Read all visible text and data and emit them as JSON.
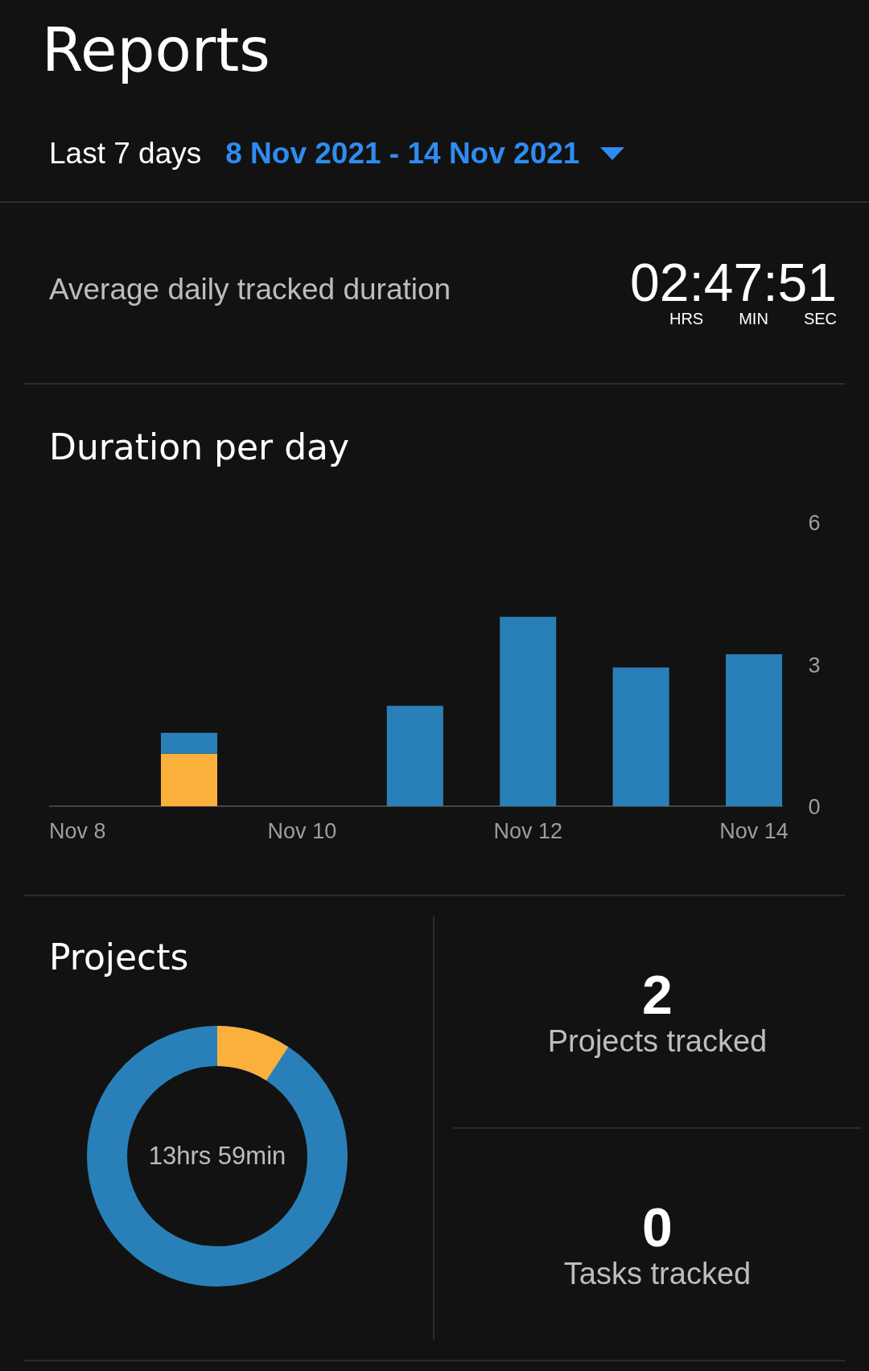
{
  "header": {
    "title": "Reports",
    "range_label": "Last 7 days",
    "date_range": "8 Nov 2021 - 14 Nov 2021"
  },
  "average": {
    "label": "Average daily tracked duration",
    "value": "02:47:51",
    "units": [
      "HRS",
      "MIN",
      "SEC"
    ]
  },
  "duration_per_day": {
    "title": "Duration per day",
    "chart_data": {
      "type": "bar",
      "stacked": true,
      "categories": [
        "Nov 8",
        null,
        "Nov 10",
        null,
        "Nov 12",
        null,
        "Nov 14"
      ],
      "ylim": [
        0,
        6
      ],
      "yticks": [
        0,
        3,
        6
      ],
      "series": [
        {
          "color": "#fbb03b",
          "values": [
            0,
            1.11,
            0,
            0,
            0,
            0,
            0
          ]
        },
        {
          "color": "#2980b9",
          "values": [
            0,
            0.44,
            0,
            2.12,
            4.0,
            2.93,
            3.21
          ]
        }
      ]
    }
  },
  "projects": {
    "title": "Projects",
    "total": "13hrs 59min"
  },
  "stats": [
    {
      "value": "2",
      "label": "Projects tracked"
    },
    {
      "value": "0",
      "label": "Tasks tracked"
    }
  ]
}
